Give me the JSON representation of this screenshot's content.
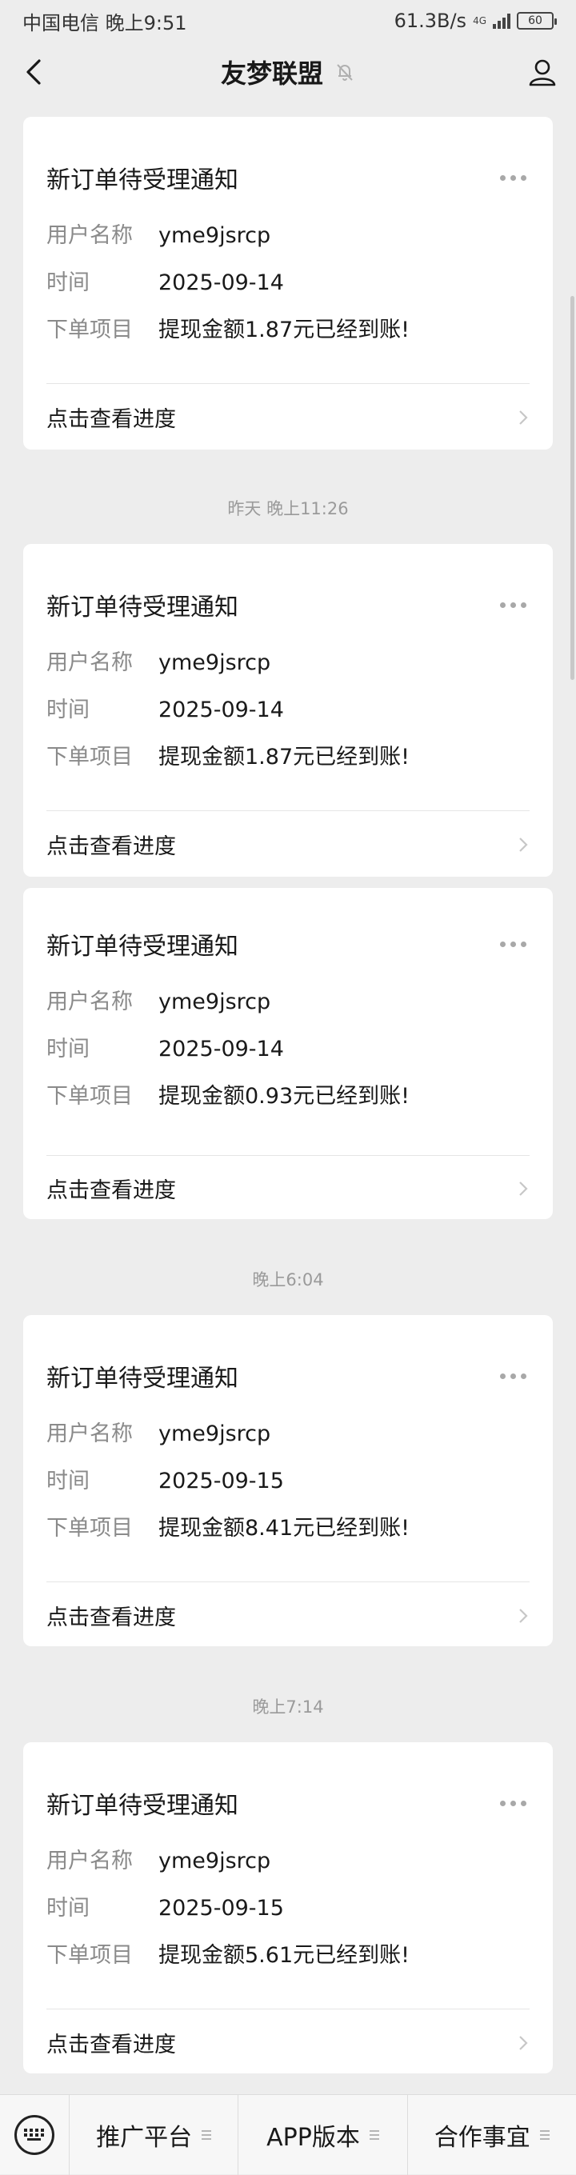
{
  "status_bar": {
    "carrier_time": "中国电信 晚上9:51",
    "network_speed": "61.3B/s",
    "network_type": "4G",
    "battery_level": "60"
  },
  "header": {
    "title": "友梦联盟",
    "back_icon": "chevron-left-icon",
    "mute_icon": "bell-off-icon",
    "profile_icon": "user-icon"
  },
  "timestamps": [
    "昨天 晚上11:26",
    "晚上6:04",
    "晚上7:14"
  ],
  "cards": [
    {
      "title": "新订单待受理通知",
      "rows": [
        {
          "label": "用户名称",
          "value": "yme9jsrcp"
        },
        {
          "label": "时间",
          "value": "2025-09-14"
        },
        {
          "label": "下单项目",
          "value": "提现金额1.87元已经到账!"
        }
      ],
      "link": "点击查看进度"
    },
    {
      "title": "新订单待受理通知",
      "rows": [
        {
          "label": "用户名称",
          "value": "yme9jsrcp"
        },
        {
          "label": "时间",
          "value": "2025-09-14"
        },
        {
          "label": "下单项目",
          "value": "提现金额1.87元已经到账!"
        }
      ],
      "link": "点击查看进度"
    },
    {
      "title": "新订单待受理通知",
      "rows": [
        {
          "label": "用户名称",
          "value": "yme9jsrcp"
        },
        {
          "label": "时间",
          "value": "2025-09-14"
        },
        {
          "label": "下单项目",
          "value": "提现金额0.93元已经到账!"
        }
      ],
      "link": "点击查看进度"
    },
    {
      "title": "新订单待受理通知",
      "rows": [
        {
          "label": "用户名称",
          "value": "yme9jsrcp"
        },
        {
          "label": "时间",
          "value": "2025-09-15"
        },
        {
          "label": "下单项目",
          "value": "提现金额8.41元已经到账!"
        }
      ],
      "link": "点击查看进度"
    },
    {
      "title": "新订单待受理通知",
      "rows": [
        {
          "label": "用户名称",
          "value": "yme9jsrcp"
        },
        {
          "label": "时间",
          "value": "2025-09-15"
        },
        {
          "label": "下单项目",
          "value": "提现金额5.61元已经到账!"
        }
      ],
      "link": "点击查看进度"
    }
  ],
  "bottom_menu": {
    "keyboard_icon": "keyboard-icon",
    "items": [
      "推广平台",
      "APP版本",
      "合作事宜"
    ]
  }
}
